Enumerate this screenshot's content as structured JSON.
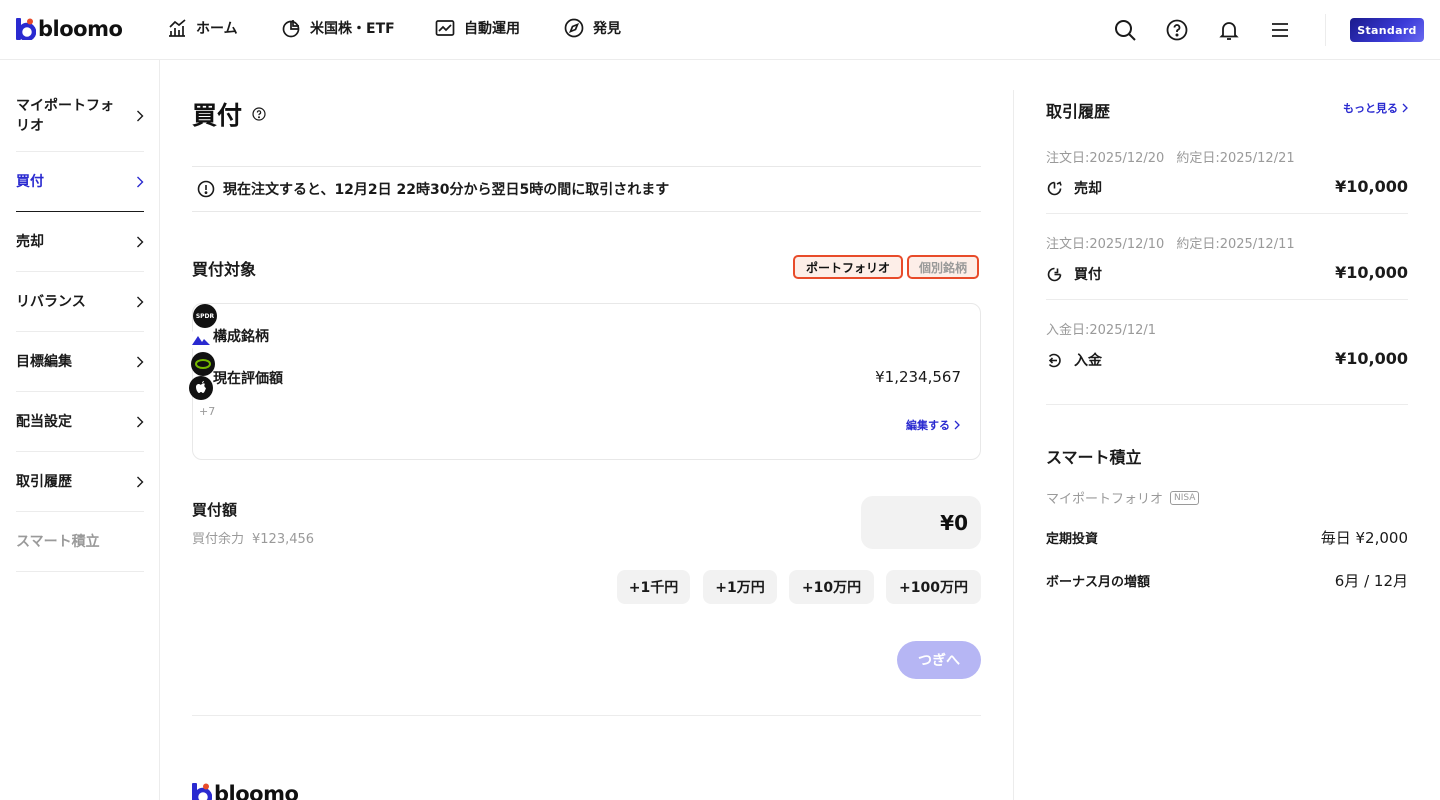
{
  "brand": {
    "name": "bloomo",
    "accent": "#2a2ad0",
    "highlight": "#e84b2a"
  },
  "nav": {
    "items": [
      {
        "label": "ホーム",
        "icon": "chart-icon"
      },
      {
        "label": "米国株・ETF",
        "icon": "pie-chart-icon"
      },
      {
        "label": "自動運用",
        "icon": "trend-icon"
      },
      {
        "label": "発見",
        "icon": "compass-icon"
      }
    ],
    "plan_badge": "Standard"
  },
  "sidebar": {
    "items": [
      {
        "label": "マイポートフォリオ",
        "state": "normal"
      },
      {
        "label": "買付",
        "state": "active"
      },
      {
        "label": "売却",
        "state": "normal"
      },
      {
        "label": "リバランス",
        "state": "normal"
      },
      {
        "label": "目標編集",
        "state": "normal"
      },
      {
        "label": "配当設定",
        "state": "normal"
      },
      {
        "label": "取引履歴",
        "state": "normal"
      },
      {
        "label": "スマート積立",
        "state": "disabled"
      }
    ]
  },
  "main": {
    "title": "買付",
    "notice": "現在注文すると、12月2日 22時30分から翌日5時の間に取引されます",
    "target": {
      "title": "買付対象",
      "segments": [
        "ポートフォリオ",
        "個別銘柄"
      ],
      "selected": "ポートフォリオ"
    },
    "card": {
      "holdings_label": "構成銘柄",
      "holdings_icons": [
        "spdr-logo",
        "mountain-logo",
        "nvidia-logo",
        "apple-logo"
      ],
      "holdings_more": "+7",
      "value_label": "現在評価額",
      "value": "¥1,234,567",
      "edit_label": "編集する"
    },
    "amount": {
      "title": "買付額",
      "available_label": "買付余力",
      "available_value": "¥123,456",
      "value": "¥0",
      "chips": [
        "+1千円",
        "+1万円",
        "+10万円",
        "+100万円"
      ]
    },
    "next_label": "つぎへ"
  },
  "history": {
    "title": "取引履歴",
    "more_label": "もっと見る",
    "items": [
      {
        "dates": [
          "注文日:2025/12/20",
          "約定日:2025/12/21"
        ],
        "type": "売却",
        "amount": "¥10,000",
        "icon": "sell-icon"
      },
      {
        "dates": [
          "注文日:2025/12/10",
          "約定日:2025/12/11"
        ],
        "type": "買付",
        "amount": "¥10,000",
        "icon": "buy-icon"
      },
      {
        "dates": [
          "入金日:2025/12/1"
        ],
        "type": "入金",
        "amount": "¥10,000",
        "icon": "deposit-icon"
      }
    ]
  },
  "smart": {
    "title": "スマート積立",
    "portfolio": "マイポートフォリオ",
    "tag": "NISA",
    "rows": [
      {
        "label": "定期投資",
        "value": "毎日 ¥2,000"
      },
      {
        "label": "ボーナス月の増額",
        "value": "6月 / 12月"
      }
    ]
  }
}
